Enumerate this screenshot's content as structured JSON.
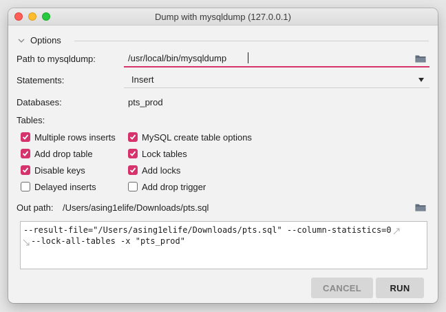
{
  "window": {
    "title": "Dump with mysqldump (127.0.0.1)"
  },
  "options": {
    "section_label": "Options",
    "path_label": "Path to mysqldump:",
    "path_value": "/usr/local/bin/mysqldump",
    "statements_label": "Statements:",
    "statements_value": "Insert",
    "databases_label": "Databases:",
    "databases_value": "pts_prod",
    "tables_label": "Tables:"
  },
  "checkboxes": [
    {
      "label": "Multiple rows inserts",
      "checked": true
    },
    {
      "label": "MySQL create table options",
      "checked": true
    },
    {
      "label": "Add drop table",
      "checked": true
    },
    {
      "label": "Lock tables",
      "checked": true
    },
    {
      "label": "Disable keys",
      "checked": true
    },
    {
      "label": "Add locks",
      "checked": true
    },
    {
      "label": "Delayed inserts",
      "checked": false
    },
    {
      "label": "Add drop trigger",
      "checked": false
    }
  ],
  "out_path": {
    "label": "Out path:",
    "value": "/Users/asing1elife/Downloads/pts.sql"
  },
  "command": {
    "line1": "--result-file=\"/Users/asing1elife/Downloads/pts.sql\" --column-statistics=0",
    "line2": "--lock-all-tables -x \"pts_prod\""
  },
  "buttons": {
    "cancel": "CANCEL",
    "run": "RUN"
  },
  "colors": {
    "accent": "#d6336c",
    "window_bg": "#f2f2f2"
  },
  "icons": {
    "folder": "folder-icon",
    "chevron": "chevron-down-icon",
    "dropdown": "dropdown-arrow-icon",
    "wrap": "soft-wrap-icon"
  }
}
